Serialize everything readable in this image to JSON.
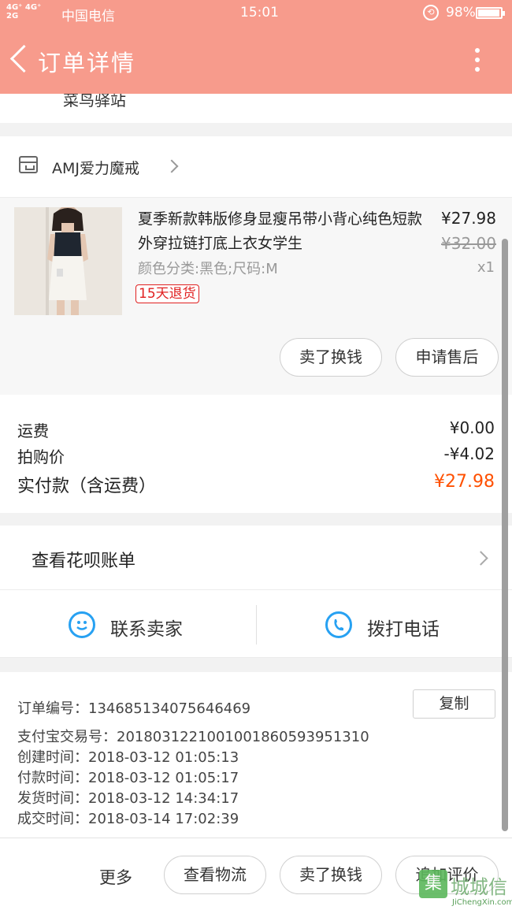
{
  "status_bar": {
    "network": "4G⁺ 4G⁺",
    "network2": "2G",
    "carrier": "中国电信",
    "time": "15:01",
    "battery": "98%",
    "battery_level": 0.98
  },
  "nav": {
    "title": "订单详情"
  },
  "address_tail": "菜鸟驿站",
  "shop": {
    "name": "AMJ爱力魔戒"
  },
  "product": {
    "title": "夏季新款韩版修身显瘦吊带小背心纯色短款外穿拉链打底上衣女学生",
    "spec": "颜色分类:黑色;尺码:M",
    "tag": "15天退货",
    "price": "¥27.98",
    "original_price": "¥32.00",
    "quantity": "x1",
    "buttons": [
      "卖了换钱",
      "申请售后"
    ]
  },
  "costs": {
    "shipping_label": "运费",
    "shipping_value": "¥0.00",
    "discount_label": "拍购价",
    "discount_value": "-¥4.02",
    "total_label": "实付款（含运费）",
    "total_value": "¥27.98"
  },
  "huabei": {
    "label": "查看花呗账单"
  },
  "contact": {
    "seller": "联系卖家",
    "phone": "拨打电话"
  },
  "order_info": {
    "order_no_label": "订单编号：",
    "order_no": "134685134075646469",
    "copy_label": "复制",
    "alipay_label": "支付宝交易号：",
    "alipay_no": "2018031221001001860593951310",
    "created_label": "创建时间：",
    "created": "2018-03-12 01:05:13",
    "paid_label": "付款时间：",
    "paid": "2018-03-12 01:05:17",
    "shipped_label": "发货时间：",
    "shipped": "2018-03-12 14:34:17",
    "completed_label": "成交时间：",
    "completed": "2018-03-14 17:02:39"
  },
  "bottom_bar": {
    "more": "更多",
    "logistics": "查看物流",
    "sell": "卖了换钱",
    "review": "追加评价"
  },
  "watermark": {
    "name": "城城信",
    "url": "JiChengXin.com"
  },
  "colors": {
    "header": "#f79b8c",
    "accent": "#ff5000",
    "icon_blue": "#27a1f2",
    "tag_red": "#e02020"
  }
}
